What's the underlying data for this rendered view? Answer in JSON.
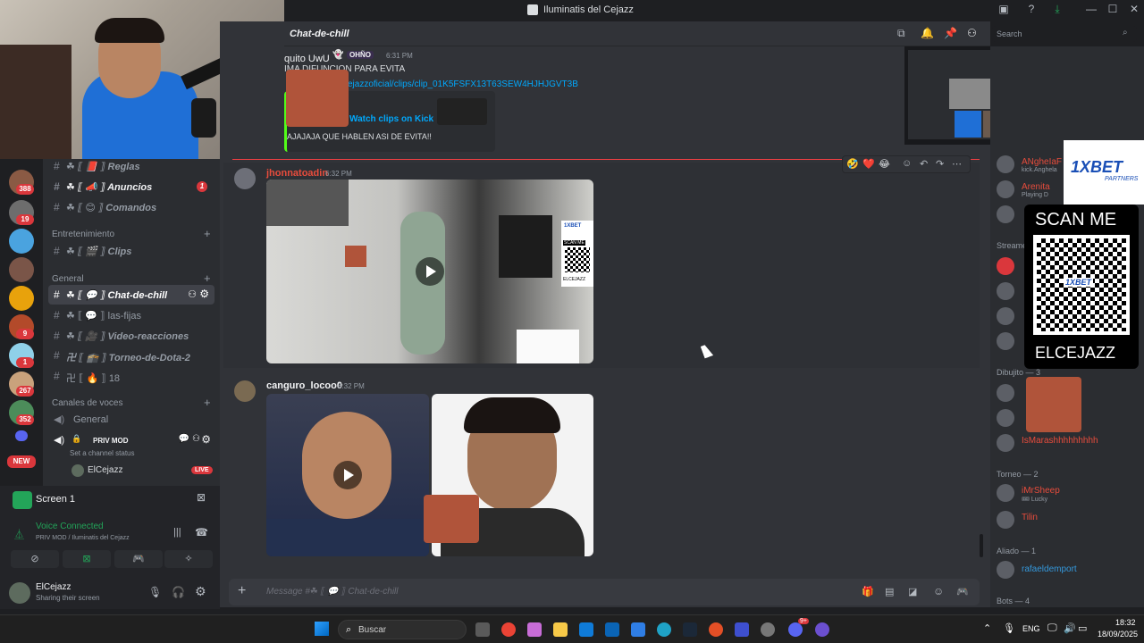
{
  "window": {
    "title": "Iluminatis del Cejazz"
  },
  "header": {
    "channel": "Chat-de-chill",
    "search_placeholder": "Search"
  },
  "servers": {
    "badges": [
      "388",
      "19",
      "9",
      "1",
      "267",
      "352"
    ],
    "new_label": "NEW"
  },
  "channels": {
    "items": [
      {
        "name": "☘ ⟦ 📕 ⟧ Reglas",
        "style": "normal"
      },
      {
        "name": "☘ ⟦ 📣 ⟧ Anuncios",
        "style": "bold",
        "badge": "1"
      },
      {
        "name": "☘ ⟦ 😊 ⟧ Comandos",
        "style": "normal"
      }
    ],
    "cat_entretenimiento": "Entretenimiento",
    "entretenimiento": [
      {
        "name": "☘ ⟦ 🎬 ⟧ Clips"
      }
    ],
    "cat_general": "General",
    "general": [
      {
        "name": "☘ ⟦ 💬 ⟧ Chat-de-chill",
        "active": true
      },
      {
        "name": "☘ ⟦ 💬 ⟧ las-fijas"
      },
      {
        "name": "☘ ⟦ 🎥 ⟧ Video-reacciones"
      },
      {
        "name": "卍 ⟦ 🕋 ⟧ Torneo-de-Dota-2"
      },
      {
        "name": "卍 ⟦ 🔥 ⟧ 18"
      }
    ],
    "cat_voice": "Canales de voces",
    "voice_general": "General",
    "priv_mod": "PRIV MOD",
    "channel_status": "Set a channel status",
    "voice_user": "ElCejazz",
    "live_label": "LIVE"
  },
  "voice": {
    "screen": "Screen 1",
    "connected": "Voice Connected",
    "location": "PRIV MOD / Iluminatis del Cejazz"
  },
  "user": {
    "name": "ElCejazz",
    "status": "Sharing their screen"
  },
  "messages": [
    {
      "author": "quito UwU",
      "tag": "OHÑO",
      "time": "6:31 PM",
      "text": "IMA DIFUNCION PARA EVITA",
      "link": "cejazzoficial/clips/clip_01K5FSFX13T63SEW4HJHJGVT3B",
      "embed_title": "Watch clips on Kick",
      "embed_desc": "AJAJAJA QUE HABLEN ASI DE EVITA!!"
    },
    {
      "author": "jhonnatoadin",
      "time": "6:32 PM"
    },
    {
      "author": "canguro_locoo0",
      "time": "6:32 PM"
    }
  ],
  "composer": {
    "placeholder": "Message #☘ ⟦ 💬 ⟧ Chat-de-chill"
  },
  "reactions": [
    "🤣",
    "❤️",
    "😂"
  ],
  "members": {
    "groups": [
      {
        "label": "Streamers"
      },
      {
        "label": "Dibujito — 3"
      },
      {
        "label": "Torneo — 2"
      },
      {
        "label": "Aliado — 1"
      },
      {
        "label": "Bots — 4"
      }
    ],
    "list": [
      {
        "name": "ANgheIaF",
        "status": "kick.Anghela",
        "color": "#e74c3c"
      },
      {
        "name": "Arenita",
        "status": "Playing D",
        "color": "#e74c3c"
      },
      {
        "name": "IsMarashhhhhhhhh",
        "color": "#e74c3c"
      },
      {
        "name": "iMrSheep",
        "status": "🎟 Lucky",
        "color": "#e74c3c"
      },
      {
        "name": "Tilin",
        "color": "#e74c3c"
      },
      {
        "name": "rafaeldemport",
        "color": "#3498db"
      }
    ]
  },
  "ad": {
    "brand": "1XBET",
    "sub": "PARTNERS",
    "scan": "SCAN ME",
    "code": "ELCEJAZZ",
    "qr_label": "1XBET"
  },
  "overlay_ad": {
    "brand": "1XBET",
    "scan": "SCAN ME",
    "code": "ELCEJAZZ"
  },
  "taskbar": {
    "search": "Buscar",
    "lang": "ENG",
    "time": "18:32",
    "date": "18/09/2025",
    "discord_badge": "9+"
  }
}
